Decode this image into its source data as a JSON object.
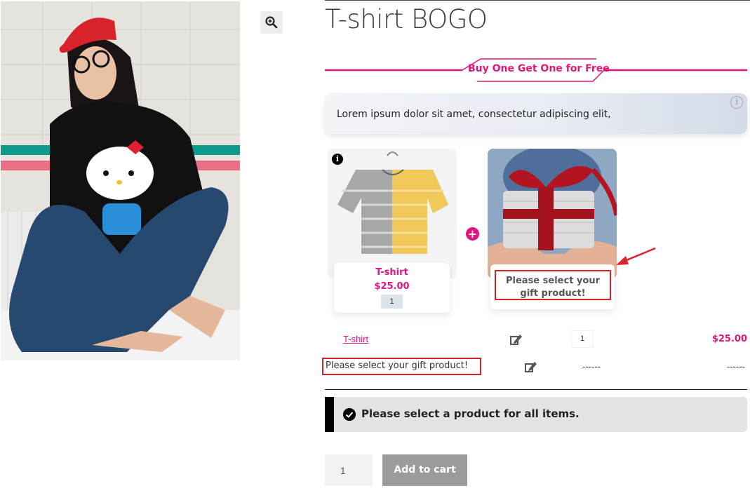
{
  "product": {
    "title": "T-shirt BOGO",
    "image_icon": "product-photo",
    "zoom_icon": "magnify-plus-icon"
  },
  "banner": {
    "text": "Buy One Get One for Free",
    "accent_color": "#e0157e"
  },
  "notice": {
    "text": "Lorem ipsum dolor sit amet, consectetur adipiscing elit,",
    "icon": "info-icon"
  },
  "bundle": {
    "item": {
      "name": "T-shirt",
      "price": "$25.00",
      "quantity": "1",
      "info_glyph": "i"
    },
    "plus_glyph": "+",
    "gift": {
      "placeholder": "Please select your gift product!"
    }
  },
  "summary": {
    "rows": [
      {
        "name": "T-shirt",
        "quantity": "1",
        "price": "$25.00",
        "edit_icon": "edit-icon"
      },
      {
        "name": "Please select your gift product!",
        "quantity": "------",
        "price": "------",
        "edit_icon": "edit-icon"
      }
    ]
  },
  "message": {
    "text": "Please select a product for all items.",
    "icon": "check-circle-icon"
  },
  "cart": {
    "quantity": "1",
    "button_label": "Add to cart",
    "button_color": "#9b9b9b"
  },
  "colors": {
    "highlight_box": "#d4232a",
    "brand": "#e0157e"
  }
}
